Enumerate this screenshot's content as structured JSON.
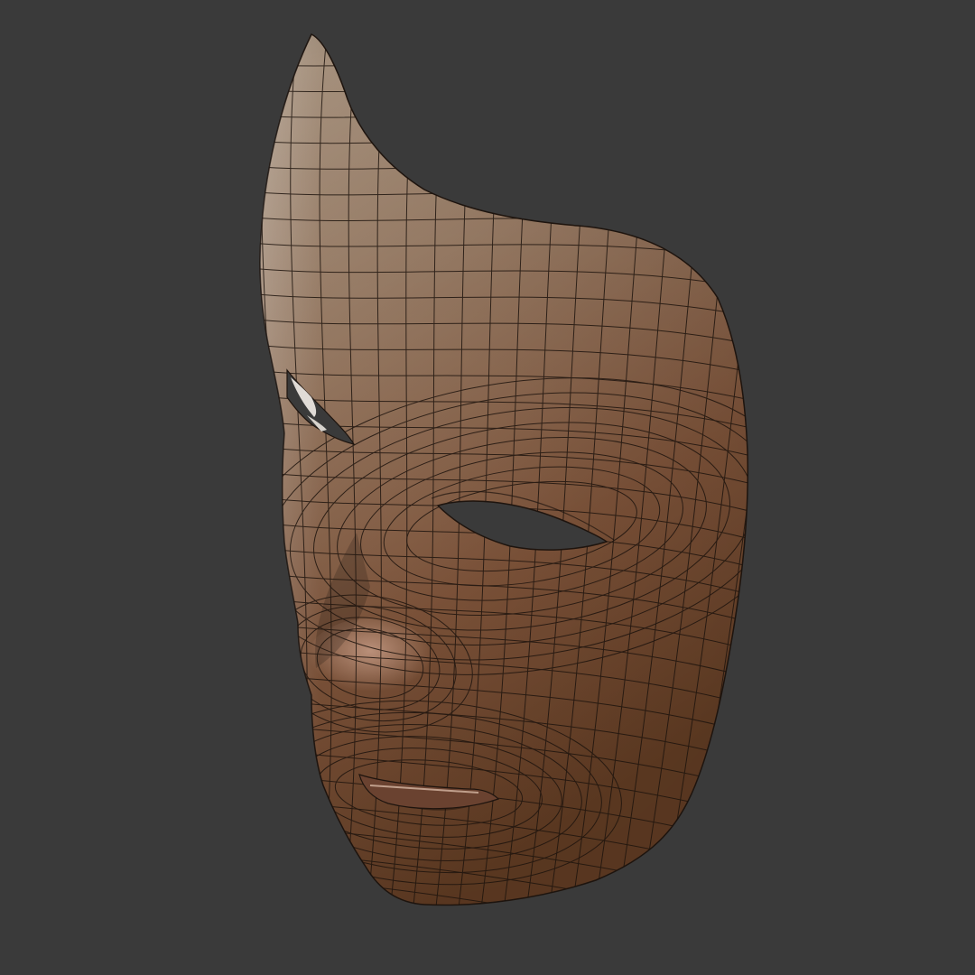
{
  "scene": {
    "subject": "mask-3d-wireframe",
    "background_color": "#3a3a3a",
    "material_light": "#b9a48f",
    "material_mid": "#8a6a52",
    "material_dark": "#5e3a22",
    "wire_color": "#1e140e",
    "interior_color": "#e9e4de"
  }
}
